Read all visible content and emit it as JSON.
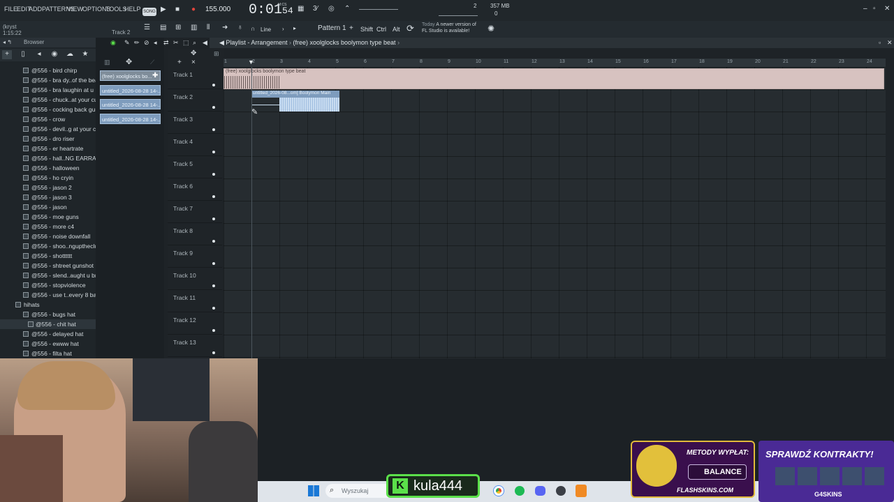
{
  "menu": [
    "FILE",
    "EDIT",
    "ADD",
    "PATTERNS",
    "VIEW",
    "OPTIONS",
    "TOOLS",
    "HELP"
  ],
  "transport": {
    "song_mode": "SONG",
    "tempo": "155.000",
    "time": "0:01",
    "time_ticks": "54",
    "mcs_label": "M:CS",
    "memory": "357 MB",
    "voices": "0",
    "meter": "2"
  },
  "hint": {
    "user": "(kryst",
    "time": "1:15:22",
    "track": "Track 2"
  },
  "toolbar": {
    "snap": "Line",
    "pattern": "Pattern 1",
    "plus": "+",
    "shift": "Shift",
    "ctrl": "Ctrl",
    "alt": "Alt",
    "news_today": "Today",
    "news_text_1": "A newer version of",
    "news_text_2": "FL Studio is available!"
  },
  "browser": {
    "title": "Browser",
    "items": [
      {
        "label": "@556 - bird chirp",
        "type": "file"
      },
      {
        "label": "@556 - bra dy..of the beat",
        "type": "file"
      },
      {
        "label": "@556 - bra laughin at u",
        "type": "file"
      },
      {
        "label": "@556 - chuck..at your cut",
        "type": "file"
      },
      {
        "label": "@556 - cocking back gun",
        "type": "file"
      },
      {
        "label": "@556 - crow",
        "type": "file"
      },
      {
        "label": "@556 - devil..g at your cut",
        "type": "file"
      },
      {
        "label": "@556 - dro riser",
        "type": "file"
      },
      {
        "label": "@556 - er heartrate",
        "type": "file"
      },
      {
        "label": "@556 - hall..NG EARRAPE)",
        "type": "file"
      },
      {
        "label": "@556 - halloween",
        "type": "file"
      },
      {
        "label": "@556 - ho cryin",
        "type": "file"
      },
      {
        "label": "@556 - jason 2",
        "type": "file"
      },
      {
        "label": "@556 - jason 3",
        "type": "file"
      },
      {
        "label": "@556 - jason",
        "type": "file"
      },
      {
        "label": "@556 - moe guns",
        "type": "file"
      },
      {
        "label": "@556 - more c4",
        "type": "file"
      },
      {
        "label": "@556 - noise downfall",
        "type": "file"
      },
      {
        "label": "@556 - shoo..nguptheclub",
        "type": "file"
      },
      {
        "label": "@556 - shotttttt",
        "type": "file"
      },
      {
        "label": "@556 - shtreet gunshot",
        "type": "file"
      },
      {
        "label": "@556 - slend..aught u bro",
        "type": "file"
      },
      {
        "label": "@556 - stopviolence",
        "type": "file"
      },
      {
        "label": "@556 - use t..every 8 bars",
        "type": "file"
      },
      {
        "label": "hihats",
        "type": "folder"
      },
      {
        "label": "@556 - bugs hat",
        "type": "file"
      },
      {
        "label": "@556 - chit hat",
        "type": "file"
      },
      {
        "label": "@556 - delayed hat",
        "type": "file"
      },
      {
        "label": "@556 - ewww hat",
        "type": "file"
      },
      {
        "label": "@556 - filta hat",
        "type": "file"
      }
    ]
  },
  "picker": [
    "(free) xoolglocks bo...",
    "untitled_2026-08-28 14-...",
    "untitled_2026-08-28 14-...",
    "untitled_2026-08-28 14-..."
  ],
  "playlist": {
    "title_1": "Playlist - Arrangement",
    "title_2": "(free) xoolglocks boolymon type beat",
    "tracks": [
      "Track 1",
      "Track 2",
      "Track 3",
      "Track 4",
      "Track 5",
      "Track 6",
      "Track 7",
      "Track 8",
      "Track 9",
      "Track 10",
      "Track 11",
      "Track 12",
      "Track 13"
    ],
    "ruler": [
      "1",
      "2",
      "3",
      "4",
      "5",
      "6",
      "7",
      "8",
      "9",
      "10",
      "11",
      "12",
      "13",
      "14",
      "15",
      "16",
      "17",
      "18",
      "19",
      "20",
      "21",
      "22",
      "23",
      "24"
    ],
    "clip1_label": "(free) xoolglocks boolymon type beat",
    "clip2_label": "untitled_2026-08...om] Boolymon Main"
  },
  "taskbar": {
    "search_placeholder": "Wyszukaj"
  },
  "overlay": {
    "kula": "kula444",
    "ad1_title": "METODY WYPŁAT:",
    "ad1_brand": "BALANCE",
    "ad1_site": "FLASHSKINS.COM",
    "ad2_title": "SPRAWDŹ KONTRAKTY!",
    "ad2_site": "G4SKINS"
  },
  "colors": {
    "accent": "#7e9cbd",
    "clip": "#d7c2c0",
    "kula_green": "#5be04a"
  }
}
